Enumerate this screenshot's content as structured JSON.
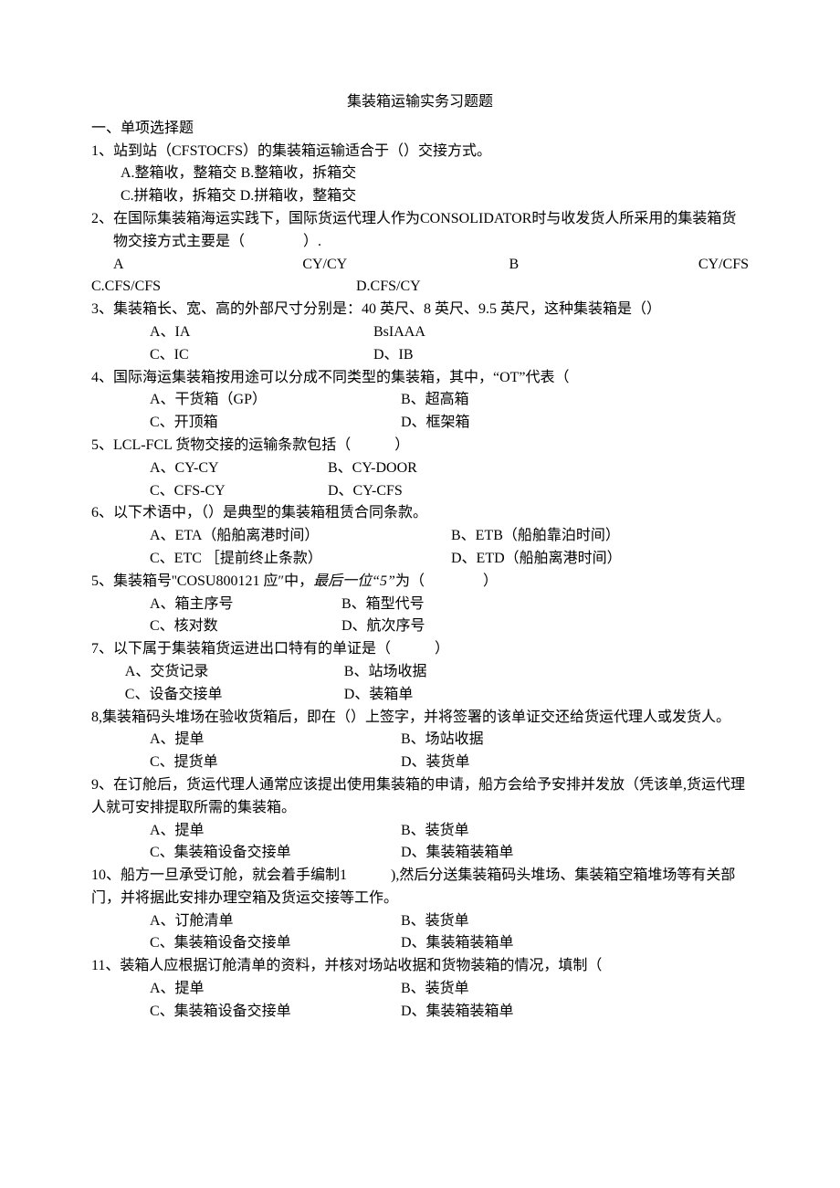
{
  "title": "集装箱运输实务习题题",
  "section": "一、单项选择题",
  "q1": {
    "stem": "1、站到站（CFSTOCFS）的集装箱运输适合于（）交接方式。",
    "a": "A.整箱收，整箱交",
    "b": "B.整箱收，拆箱交",
    "c": "C.拼箱收，拆箱交",
    "d": "D.拼箱收，整箱交"
  },
  "q2": {
    "stem": "2、在国际集装箱海运实践下，国际货运代理人作为CONSOLIDATOR时与收发货人所采用的集装箱货物交接方式主要是（　　　　）.",
    "a": "A",
    "av": "CY/CY",
    "b": "B",
    "bv": "CY/CFS",
    "c": "C.CFS/CFS",
    "d": "D.CFS/CY"
  },
  "q3": {
    "stem": "3、集装箱长、宽、高的外部尺寸分别是：40 英尺、8 英尺、9.5 英尺，这种集装箱是（）",
    "a": "A、IA",
    "b": "BsIAAA",
    "c": "C、IC",
    "d": "D、IB"
  },
  "q4": {
    "stem": "4、国际海运集装箱按用途可以分成不同类型的集装箱，其中，“OT”代表（",
    "a": "A、干货箱（GP）",
    "b": "B、超高箱",
    "c": "C、开顶箱",
    "d": "D、框架箱"
  },
  "q5": {
    "stem": "5、LCL-FCL 货物交接的运输条款包括（　　　）",
    "a": "A、CY-CY",
    "b": "B、CY-DOOR",
    "c": "C、CFS-CY",
    "d": "D、CY-CFS"
  },
  "q6": {
    "stem": "6、以下术语中，（）是典型的集装箱租赁合同条款。",
    "a": "A、ETA（船舶离港时间）",
    "b": "B、ETB（船舶靠泊时间）",
    "c": "C、ETC ［提前终止条款）",
    "d": "D、ETD（船舶离港时间）"
  },
  "q5b": {
    "stem_a": "5、集装箱号''COSU800121 应″中，",
    "stem_b": "最后一位“5”",
    "stem_c": "为（　　　　）",
    "a": "A、箱主序号",
    "b": "B、箱型代号",
    "c": "C、核对数",
    "d": "D、航次序号"
  },
  "q7": {
    "stem": "7、以下属于集装箱货运进出口特有的单证是（　　　）",
    "a": "A、交货记录",
    "b": "B、站场收据",
    "c": "C、设备交接单",
    "d": "D、装箱单"
  },
  "q8": {
    "stem": "8,集装箱码头堆场在验收货箱后，即在（）上签字，并将签署的该单证交还给货运代理人或发货人。",
    "a": "A、提单",
    "b": "B、场站收据",
    "c": "C、提货单",
    "d": "D、装货单"
  },
  "q9": {
    "stem": "9、在订舱后，货运代理人通常应该提出使用集装箱的申请，船方会给予安排并发放（凭该单,货运代理人就可安排提取所需的集装箱。",
    "a": "A、提单",
    "b": "B、装货单",
    "c": "C、集装箱设备交接单",
    "d": "D、集装箱装箱单"
  },
  "q10": {
    "stem": "10、船方一旦承受订舱，就会着手编制1　　　),然后分送集装箱码头堆场、集装箱空箱堆场等有关部门，并将据此安排办理空箱及货运交接等工作。",
    "a": "A、订舱清单",
    "b": "B、装货单",
    "c": "C、集装箱设备交接单",
    "d": "D、集装箱装箱单"
  },
  "q11": {
    "stem": "11、装箱人应根据订舱清单的资料，并核对场站收据和货物装箱的情况，填制（",
    "a": "A、提单",
    "b": "B、装货单",
    "c": "C、集装箱设备交接单",
    "d": "D、集装箱装箱单"
  }
}
